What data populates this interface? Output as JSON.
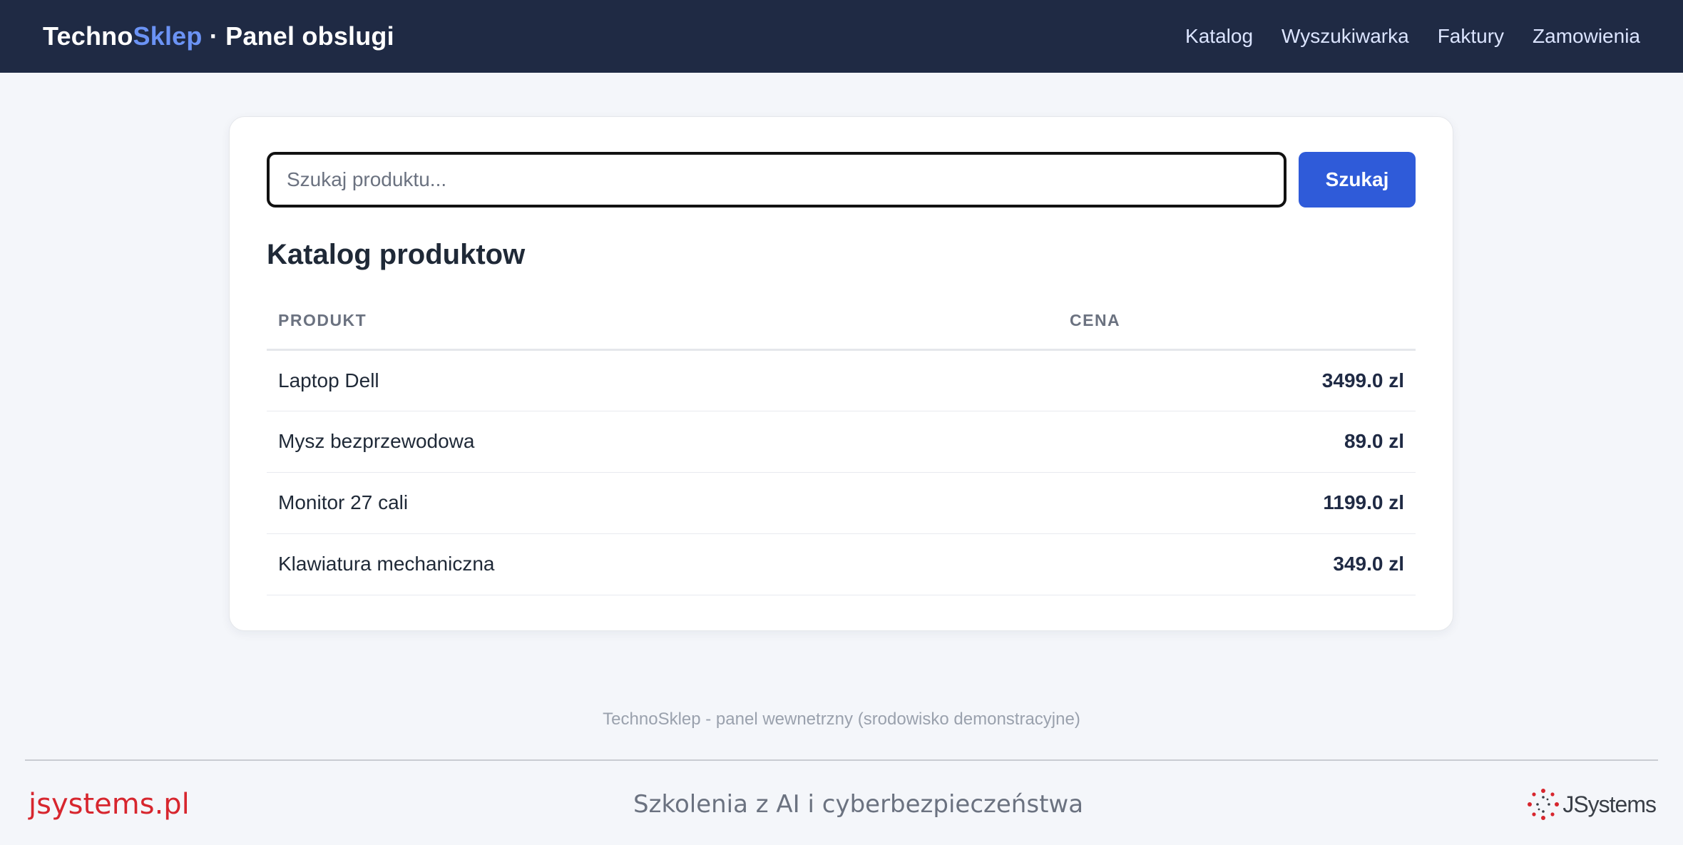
{
  "header": {
    "brand_part1": "Techno",
    "brand_part2": "Sklep",
    "brand_suffix": " · Panel obslugi",
    "nav": [
      "Katalog",
      "Wyszukiwarka",
      "Faktury",
      "Zamowienia"
    ]
  },
  "search": {
    "value": "",
    "placeholder": "Szukaj produktu...",
    "button_label": "Szukaj"
  },
  "catalog": {
    "title": "Katalog produktow",
    "columns": [
      "PRODUKT",
      "CENA"
    ],
    "rows": [
      {
        "name": "Laptop Dell",
        "price": "3499.0 zl"
      },
      {
        "name": "Mysz bezprzewodowa",
        "price": "89.0 zl"
      },
      {
        "name": "Monitor 27 cali",
        "price": "1199.0 zl"
      },
      {
        "name": "Klawiatura mechaniczna",
        "price": "349.0 zl"
      }
    ]
  },
  "footer": {
    "note": "TechnoSklep - panel wewnetrzny (srodowisko demonstracyjne)",
    "site": "jsystems.pl",
    "tagline": "Szkolenia z AI i cyberbezpieczeństwa",
    "logo_text": "JSystems"
  },
  "colors": {
    "header_bg": "#1f2a44",
    "brand_accent": "#6b93f5",
    "primary_button": "#2f5bd9",
    "site_red": "#d7262e"
  }
}
